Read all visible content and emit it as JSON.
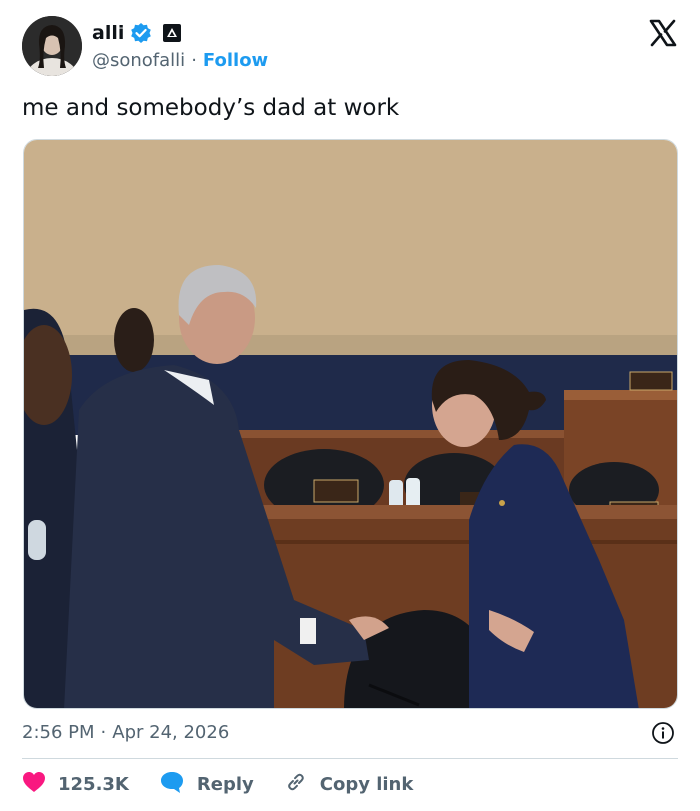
{
  "author": {
    "display_name": "alli",
    "handle": "@sonofalli",
    "separator": "·",
    "follow_label": "Follow",
    "verified": true
  },
  "tweet": {
    "text": "me and somebody’s dad at work"
  },
  "media": {
    "alt": "photo"
  },
  "meta": {
    "time": "2:56 PM",
    "separator": "·",
    "date": "Apr 24, 2026"
  },
  "actions": {
    "like_count": "125.3K",
    "reply_label": "Reply",
    "copy_label": "Copy link"
  },
  "colors": {
    "accent": "#1d9bf0",
    "like": "#f91880",
    "text": "#0f1419",
    "muted": "#536471"
  }
}
